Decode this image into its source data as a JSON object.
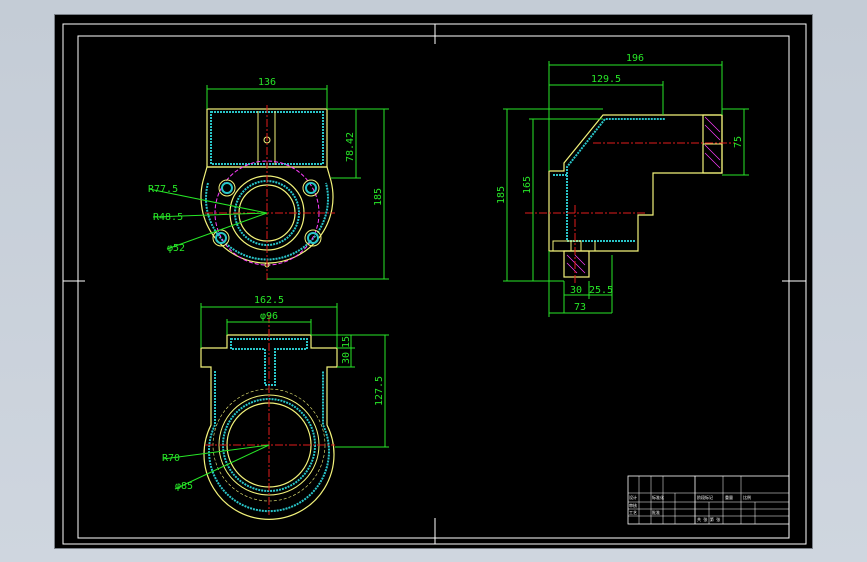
{
  "drawing": {
    "colors": {
      "sheet": "#000000",
      "frame": "#ffffff",
      "outline": "#f2f27a",
      "dimension": "#27e627",
      "centerline": "#e01c1c",
      "hatch": "#29c5c9",
      "hidden": "#ff3fff"
    },
    "top_view": {
      "width_dim": "136",
      "height_dim": "78.42",
      "overall_dim": "185",
      "r1": "R77.5",
      "r2": "R48.5",
      "d1": "φ52"
    },
    "front_view": {
      "width_dim": "162.5",
      "inner_dim": "φ96",
      "d1": "15",
      "d2": "30",
      "height_dim": "127.5",
      "r1": "R70",
      "d3": "φ85"
    },
    "side_view": {
      "width_dim": "196",
      "width2_dim": "129.5",
      "height_dim": "185",
      "height2_dim": "165",
      "right_dim": "75",
      "b1": "30",
      "b2": "25.5",
      "b3": "73"
    },
    "title_block": {
      "row1": [
        "设计",
        "标准化",
        "",
        "",
        ""
      ],
      "row2": [
        "审核",
        "",
        "",
        "",
        ""
      ],
      "row3": [
        "工艺",
        "批准",
        "",
        "",
        ""
      ],
      "stage": "阶段标记",
      "weight": "重量",
      "scale": "比例",
      "sheet_of": "共 张 第 张"
    }
  }
}
